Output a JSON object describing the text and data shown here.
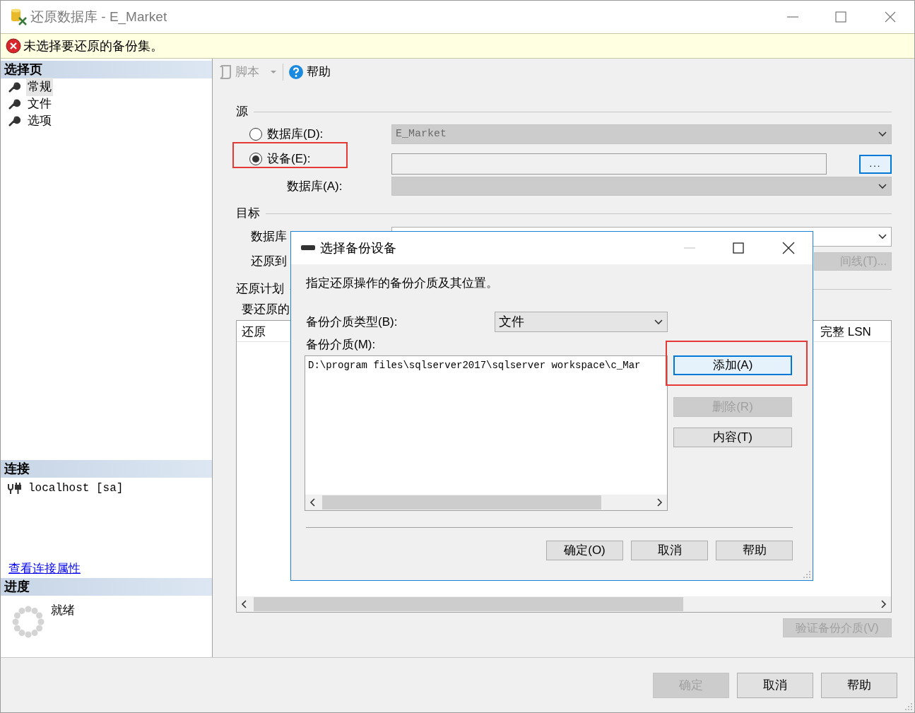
{
  "window": {
    "title": "还原数据库 - E_Market"
  },
  "error_banner": {
    "message": "未选择要还原的备份集。"
  },
  "sidebar": {
    "pages_header": "选择页",
    "pages": [
      {
        "label": "常规",
        "selected": true
      },
      {
        "label": "文件",
        "selected": false
      },
      {
        "label": "选项",
        "selected": false
      }
    ],
    "connection_header": "连接",
    "connection": "localhost [sa]",
    "connection_link": "查看连接属性",
    "progress_header": "进度",
    "progress_status": "就绪"
  },
  "toolbar": [
    {
      "kind": "script",
      "label": "脚本",
      "disabled": true
    },
    {
      "kind": "help",
      "label": "帮助",
      "disabled": false
    }
  ],
  "source": {
    "title": "源",
    "options": [
      {
        "label": "数据库(D):",
        "selected": false
      },
      {
        "label": "设备(E):",
        "selected": true
      }
    ],
    "database_value": "E_Market",
    "browse_button": "...",
    "database_label": "数据库(A):"
  },
  "destination": {
    "title": "目标",
    "database_label": "数据库",
    "restore_to_label": "还原到",
    "timeline_button": "间线(T)..."
  },
  "plan": {
    "title": "还原计划",
    "sets_label": "要还原的",
    "columns": [
      "还原",
      "完整 LSN"
    ],
    "verify_button": "验证备份介质(V)"
  },
  "dialog": {
    "title": "选择备份设备",
    "description": "指定还原操作的备份介质及其位置。",
    "media_type_label": "备份介质类型(B):",
    "media_type_value": "文件",
    "media_label": "备份介质(M):",
    "media_items": [
      "D:\\program files\\sqlserver2017\\sqlserver workspace\\c_Mar"
    ],
    "side_buttons": [
      {
        "label": "添加(A)",
        "disabled": false,
        "focused": true
      },
      {
        "label": "删除(R)",
        "disabled": true,
        "focused": false
      },
      {
        "label": "内容(T)",
        "disabled": false,
        "focused": false
      }
    ],
    "buttons": [
      {
        "label": "确定(O)",
        "disabled": false
      },
      {
        "label": "取消",
        "disabled": false
      },
      {
        "label": "帮助",
        "disabled": false
      }
    ]
  },
  "buttons": [
    {
      "label": "确定",
      "disabled": true
    },
    {
      "label": "取消",
      "disabled": false
    },
    {
      "label": "帮助",
      "disabled": false
    }
  ]
}
